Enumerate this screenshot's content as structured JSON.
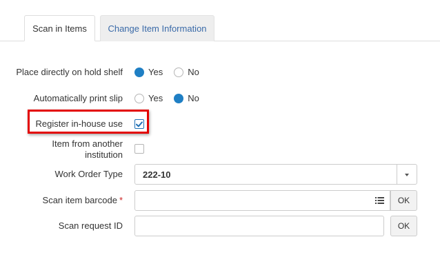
{
  "tabs": [
    {
      "label": "Scan in Items",
      "active": true
    },
    {
      "label": "Change Item Information",
      "active": false
    }
  ],
  "form": {
    "hold_shelf": {
      "label": "Place directly on hold shelf",
      "yes": "Yes",
      "no": "No",
      "selected": "Yes"
    },
    "print_slip": {
      "label": "Automatically print slip",
      "yes": "Yes",
      "no": "No",
      "selected": "No"
    },
    "in_house": {
      "label": "Register in-house use",
      "checked": true
    },
    "other_institution": {
      "label_line1": "Item from another",
      "label_line2": "institution",
      "checked": false
    },
    "work_order": {
      "label": "Work Order Type",
      "value": "222-10"
    },
    "item_barcode": {
      "label": "Scan item barcode",
      "required_mark": "*",
      "value": "",
      "ok_label": "OK"
    },
    "request_id": {
      "label": "Scan request ID",
      "value": "",
      "ok_label": "OK"
    }
  },
  "colors": {
    "accent": "#1f7fc4",
    "highlight_border": "#e30000",
    "tab_link": "#3a6aa8",
    "required": "#cc2222"
  }
}
